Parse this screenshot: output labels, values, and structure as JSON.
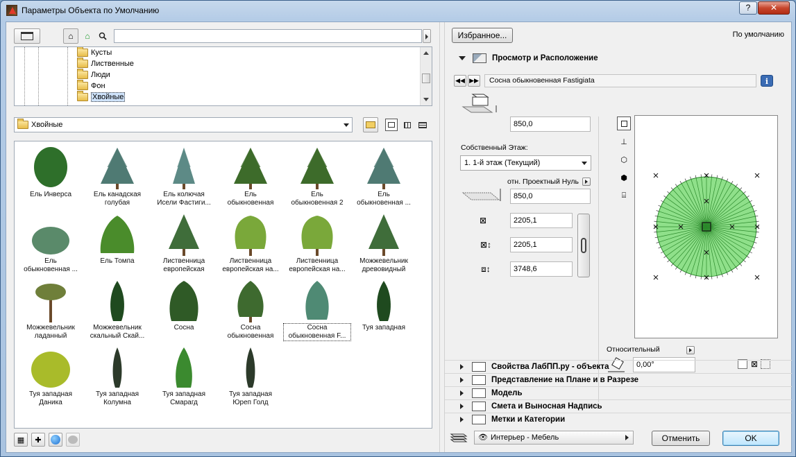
{
  "window": {
    "title": "Параметры Объекта по Умолчанию",
    "help_label": "?",
    "close_label": "✕"
  },
  "toolbar": {
    "search_placeholder": "",
    "icons": [
      "view-mode-icon",
      "library-icon",
      "library-green-icon",
      "search-icon"
    ]
  },
  "tree": {
    "items": [
      "Кусты",
      "Лиственные",
      "Люди",
      "Фон",
      "Хвойные"
    ],
    "selected": "Хвойные"
  },
  "path": {
    "current": "Хвойные"
  },
  "gallery": {
    "items": [
      {
        "label1": "Ель Инверса",
        "label2": "",
        "kind": "spruce-dense"
      },
      {
        "label1": "Ель канадская",
        "label2": "голубая",
        "kind": "spruce-blue"
      },
      {
        "label1": "Ель колючая",
        "label2": "Исели Фастиги...",
        "kind": "spruce-narrow"
      },
      {
        "label1": "Ель",
        "label2": "обыкновенная",
        "kind": "spruce"
      },
      {
        "label1": "Ель",
        "label2": "обыкновенная 2",
        "kind": "spruce"
      },
      {
        "label1": "Ель",
        "label2": "обыкновенная ...",
        "kind": "spruce-blue"
      },
      {
        "label1": "Ель",
        "label2": "обыкновенная ...",
        "kind": "bush-round"
      },
      {
        "label1": "Ель Томпа",
        "label2": "",
        "kind": "bush-cone"
      },
      {
        "label1": "Лиственница",
        "label2": "европейская",
        "kind": "larch"
      },
      {
        "label1": "Лиственница",
        "label2": "европейская на...",
        "kind": "weeping"
      },
      {
        "label1": "Лиственница",
        "label2": "европейская на...",
        "kind": "weeping"
      },
      {
        "label1": "Можжевельник",
        "label2": "древовидный",
        "kind": "larch"
      },
      {
        "label1": "Можжевельник",
        "label2": "ладанный",
        "kind": "umbrella"
      },
      {
        "label1": "Можжевельник",
        "label2": "скальный Скай...",
        "kind": "column-dark"
      },
      {
        "label1": "Сосна",
        "label2": "",
        "kind": "pine-round"
      },
      {
        "label1": "Сосна",
        "label2": "обыкновенная",
        "kind": "pine"
      },
      {
        "label1": "Сосна",
        "label2": "обыкновенная F...",
        "kind": "pine-blue"
      },
      {
        "label1": "Туя западная",
        "label2": "",
        "kind": "column-dark"
      },
      {
        "label1": "Туя западная",
        "label2": "Даника",
        "kind": "bush-yellow"
      },
      {
        "label1": "Туя западная",
        "label2": "Колумна",
        "kind": "column-narrow"
      },
      {
        "label1": "Туя западная",
        "label2": "Смарагд",
        "kind": "column-bright"
      },
      {
        "label1": "Туя западная",
        "label2": "Юреп Голд",
        "kind": "column-narrow"
      }
    ],
    "selected_index": 16
  },
  "right": {
    "favorites_label": "Избранное...",
    "default_label": "По умолчанию",
    "section_view": "Просмотр и Расположение",
    "object_name": "Сосна обыкновенная Fastigiata",
    "height_value": "850,0",
    "story_label": "Собственный Этаж:",
    "story_value": "1. 1-й этаж (Текущий)",
    "rel_zero_label": "отн. Проектный Нуль",
    "elevation_value": "850,0",
    "dim_x": "2205,1",
    "dim_y": "2205,1",
    "dim_z": "3748,6",
    "relative_label": "Относительный",
    "angle_value": "0,00°",
    "sections": [
      "Свойства ЛабПП.ру - объекта",
      "Представление на Плане и в Разрезе",
      "Модель",
      "Смета и Выносная Надпись",
      "Метки и Категории"
    ]
  },
  "footer": {
    "layer_value": "Интерьер - Мебель",
    "cancel_label": "Отменить",
    "ok_label": "OK"
  },
  "colors": {
    "accent": "#3c7fb1",
    "preview_fill": "#8fe08a",
    "preview_stroke": "#2c8a2c"
  }
}
